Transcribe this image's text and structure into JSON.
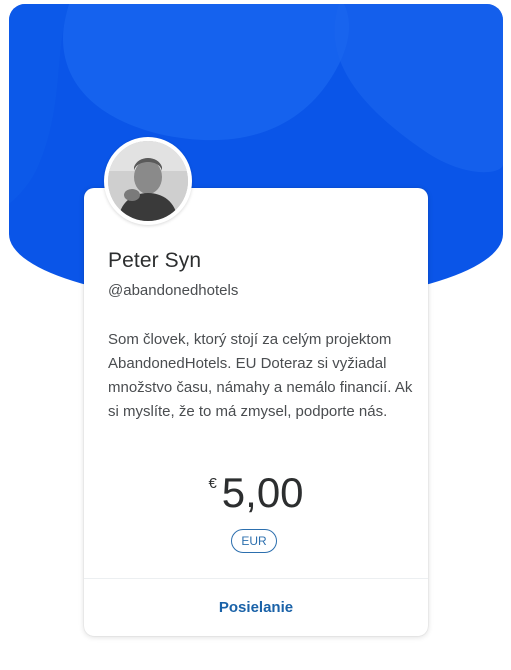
{
  "profile": {
    "name": "Peter Syn",
    "handle": "@abandonedhotels",
    "bio": "Som človek, ktorý stojí za celým projektom AbandonedHotels. EU Doteraz si vyžiadal množstvo času, námahy a nemálo financií. Ak si myslíte, že to má zmysel, podporte nás."
  },
  "payment": {
    "currency_symbol": "€",
    "amount": "5,00",
    "currency_code": "EUR"
  },
  "actions": {
    "send_label": "Posielanie"
  },
  "colors": {
    "banner": "#0a55e8",
    "banner_light": "#1f7af5",
    "link": "#1a62a8",
    "text": "#2c2e2f"
  }
}
